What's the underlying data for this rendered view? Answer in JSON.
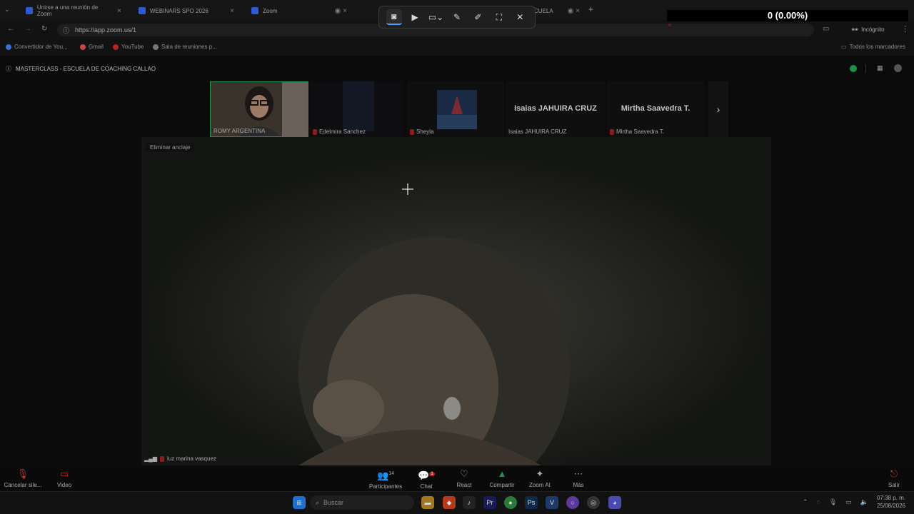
{
  "browser": {
    "tabs": [
      {
        "label": "Unirse a una reunión de Zoom"
      },
      {
        "label": "WEBINARS SPO 2026"
      },
      {
        "label": "Zoom"
      },
      {
        "label": "CUELA"
      }
    ],
    "new_tab_symbol": "+",
    "url": "https://app.zoom.us/1",
    "mode_label": "Incógnito",
    "bookmarks": [
      {
        "label": "Convertidor de You..."
      },
      {
        "label": "Gmail"
      },
      {
        "label": "YouTube"
      },
      {
        "label": "Sala de reuniones p..."
      }
    ],
    "all_bookmarks_label": "Todos los marcadores"
  },
  "stats_overlay": {
    "text": "0 (0.00%)"
  },
  "meeting": {
    "title": "MASTERCLASS - ESCUELA DE COACHING CALLAO",
    "unpin_label": "Eliminar anclaje",
    "active_speaker": "luz marina vasquez",
    "participants_strip": [
      {
        "name": "ROMY ARGENTINA",
        "big_label": ""
      },
      {
        "name": "Edelmira Sanchez",
        "big_label": ""
      },
      {
        "name": "Sheyla",
        "big_label": ""
      },
      {
        "name": "Isaias JAHUIRA CRUZ",
        "big_label": "Isaias JAHUIRA CRUZ"
      },
      {
        "name": "Mirtha Saavedra T.",
        "big_label": "Mirtha Saavedra T."
      }
    ]
  },
  "controls": {
    "left": [
      {
        "label": "Cancelar sile...",
        "icon": "mic-muted-icon"
      },
      {
        "label": "Video",
        "icon": "video-off-icon"
      }
    ],
    "center": [
      {
        "label": "Participantes",
        "icon": "participants-icon",
        "badge": "14"
      },
      {
        "label": "Chat",
        "icon": "chat-icon",
        "badge": "1"
      },
      {
        "label": "React",
        "icon": "heart-icon"
      },
      {
        "label": "Compartir",
        "icon": "share-icon"
      },
      {
        "label": "Zoom AI",
        "icon": "sparkle-icon"
      },
      {
        "label": "Más",
        "icon": "more-icon"
      }
    ],
    "leave_label": "Salir"
  },
  "taskbar": {
    "search_placeholder": "Buscar",
    "time": "07:38 p. m.",
    "date": "25/08/2026"
  },
  "colors": {
    "accent_green": "#1f8f4a",
    "zoom_blue": "#2d5bd1",
    "muted_red": "#8b1d1d"
  }
}
